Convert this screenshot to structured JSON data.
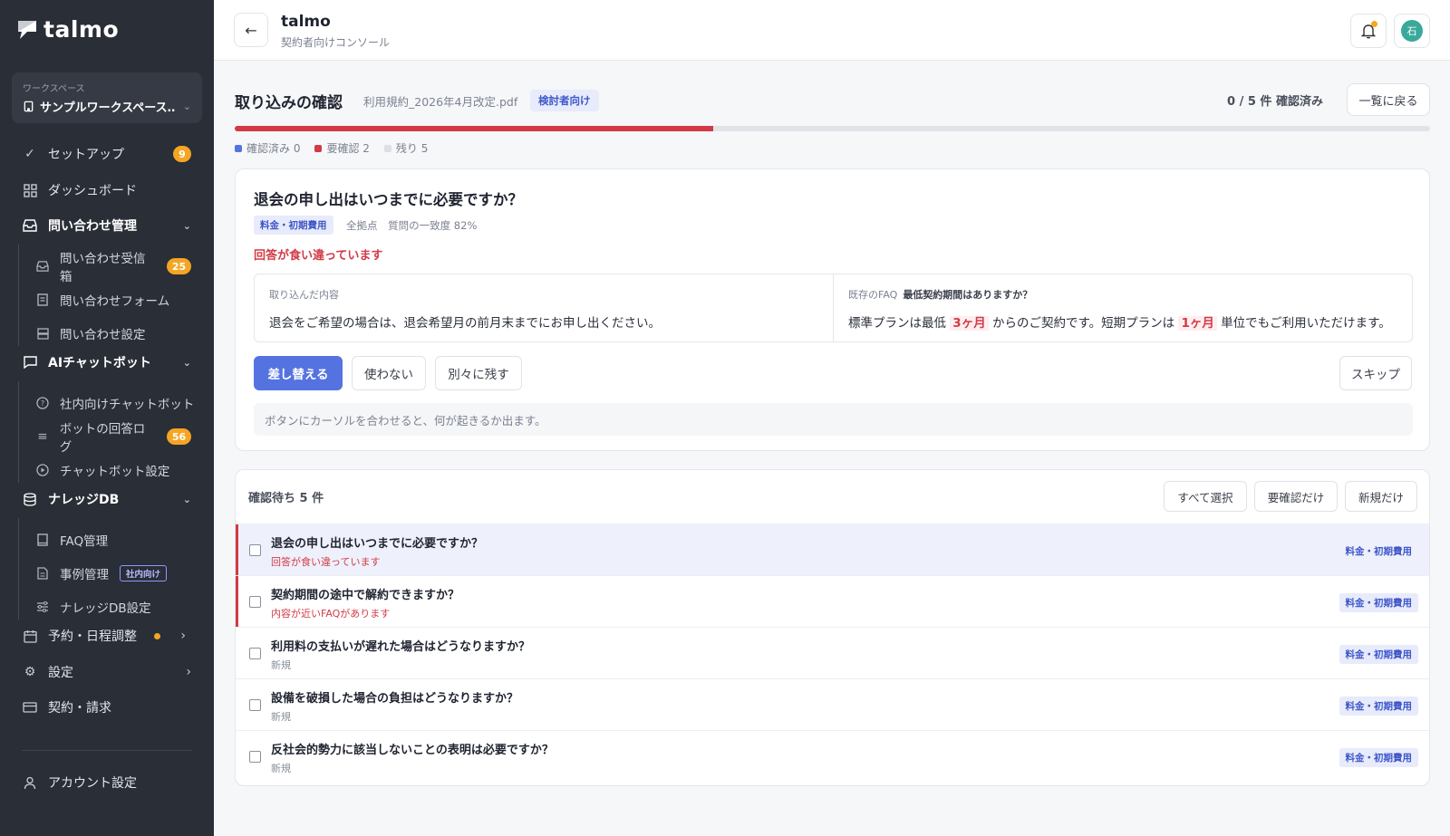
{
  "sidebar": {
    "logo": "talmo",
    "workspace_label": "ワークスペース",
    "workspace_name": "サンプルワークスペース…",
    "items": {
      "setup": {
        "label": "セットアップ",
        "badge": "9"
      },
      "dashboard": {
        "label": "ダッシュボード"
      },
      "inquiry": {
        "label": "問い合わせ管理"
      },
      "inquiry_inbox": {
        "label": "問い合わせ受信箱",
        "badge": "25"
      },
      "inquiry_form": {
        "label": "問い合わせフォーム"
      },
      "inquiry_settings": {
        "label": "問い合わせ設定"
      },
      "ai_chatbot": {
        "label": "AIチャットボット"
      },
      "internal_chatbot": {
        "label": "社内向けチャットボット"
      },
      "bot_log": {
        "label": "ボットの回答ログ",
        "badge": "56"
      },
      "chatbot_settings": {
        "label": "チャットボット設定"
      },
      "knowledge_db": {
        "label": "ナレッジDB"
      },
      "faq": {
        "label": "FAQ管理"
      },
      "cases": {
        "label": "事例管理",
        "tag": "社内向け"
      },
      "knowledge_settings": {
        "label": "ナレッジDB設定"
      },
      "booking": {
        "label": "予約・日程調整"
      },
      "settings": {
        "label": "設定"
      },
      "billing": {
        "label": "契約・請求"
      },
      "account": {
        "label": "アカウント設定"
      }
    }
  },
  "header": {
    "title": "talmo",
    "subtitle": "契約者向けコンソール",
    "avatar_initial": "石"
  },
  "review": {
    "title": "取り込みの確認",
    "file_name": "利用規約_2026年4月改定.pdf",
    "audience": "検討者向け",
    "progress_text": "0 / 5 件 確認済み",
    "back_to_list": "一覧に戻る",
    "progress_fraction": 0.4,
    "legend": {
      "confirmed": "確認済み 0",
      "needs_review": "要確認 2",
      "remaining": "残り 5"
    },
    "colors": {
      "confirmed": "#5573e0",
      "needs_review": "#d23a46",
      "remaining": "#dcdfe5"
    }
  },
  "detail": {
    "question": "退会の申し出はいつまでに必要ですか？",
    "category": "料金・初期費用",
    "scope": "全拠点",
    "match": "質問の一致度 82%",
    "conflict": "回答が食い違っています",
    "imported_label": "取り込んだ内容",
    "imported_text": "退会をご希望の場合は、退会希望月の前月末までにお申し出ください。",
    "existing_label": "既存のFAQ",
    "existing_question": "最低契約期間はありますか？",
    "existing_text_1": "標準プランは最低",
    "existing_hl_1": "3ヶ月",
    "existing_text_2": "からのご契約です。短期プランは",
    "existing_hl_2": "1ヶ月",
    "existing_text_3": "単位でもご利用いただけます。",
    "btn_replace": "差し替える",
    "btn_unused": "使わない",
    "btn_keep_separate": "別々に残す",
    "btn_skip": "スキップ",
    "hint": "ボタンにカーソルを合わせると、何が起きるか出ます。"
  },
  "queue": {
    "title": "確認待ち 5 件",
    "select_all": "すべて選択",
    "needs_review_only": "要確認だけ",
    "new_only": "新規だけ",
    "rows": [
      {
        "title": "退会の申し出はいつまでに必要ですか？",
        "status": "回答が食い違っています",
        "tag": "料金・初期費用"
      },
      {
        "title": "契約期間の途中で解約できますか？",
        "status": "内容が近いFAQがあります",
        "tag": "料金・初期費用"
      },
      {
        "title": "利用料の支払いが遅れた場合はどうなりますか？",
        "status": "新規",
        "tag": "料金・初期費用"
      },
      {
        "title": "設備を破損した場合の負担はどうなりますか？",
        "status": "新規",
        "tag": "料金・初期費用"
      },
      {
        "title": "反社会的勢力に該当しないことの表明は必要ですか？",
        "status": "新規",
        "tag": "料金・初期費用"
      }
    ]
  }
}
